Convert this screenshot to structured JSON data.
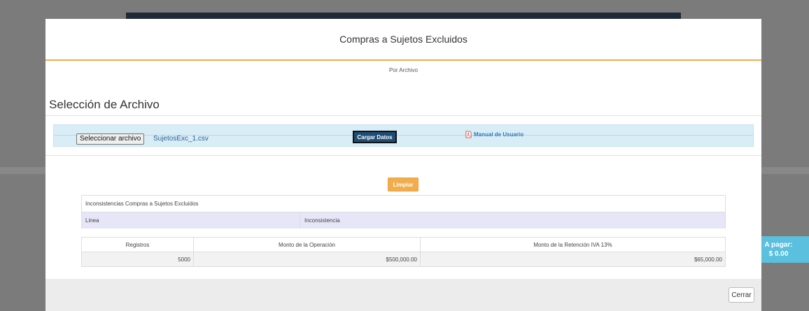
{
  "modal": {
    "title": "Compras a Sujetos Excluidos",
    "method_label": "Por Archivo",
    "section_title": "Selección de Archivo"
  },
  "upload": {
    "choose_file_label": "Seleccionar archivo",
    "file_name": "SujetosExc_1.csv",
    "load_button": "Cargar Datos",
    "manual_link": "Manual de Usuario",
    "manual_icon": "pdf-icon"
  },
  "clear_button": "Limpiar",
  "inconsistencies": {
    "title": "Inconsistencias Compras a Sujetos Excluidos",
    "columns": [
      "Linea",
      "Inconsistencia"
    ]
  },
  "summary": {
    "columns": [
      "Registros",
      "Monto de la Operación",
      "Monto de la Retención IVA 13%"
    ],
    "row": [
      "5000",
      "$500,000.00",
      "$65,000.00"
    ]
  },
  "pay_badge": {
    "label": "A pagar:",
    "amount": "$ 0.00"
  },
  "close_button": "Cerrar",
  "colors": {
    "accent": "#f0ad4e",
    "panel": "#d9edf7",
    "primary_dark": "#204d74",
    "info": "#5bc0de"
  }
}
